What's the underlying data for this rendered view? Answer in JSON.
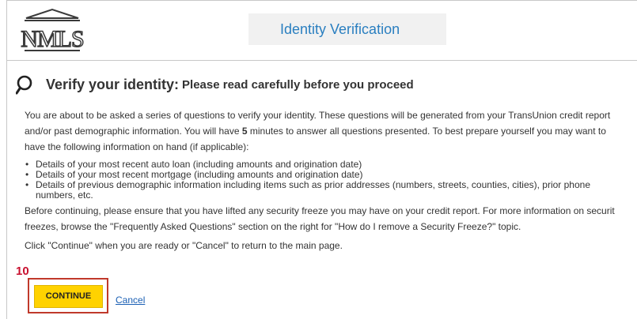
{
  "header": {
    "logo_text": "NMLS",
    "title": "Identity Verification"
  },
  "verify": {
    "title": "Verify your identity:",
    "subtitle": "Please read carefully before you proceed"
  },
  "intro": {
    "line1": "You are about to be asked a series of questions to verify your identity. These questions will be generated from your TransUnion credit report",
    "line2_a": "and/or past demographic information. You will have ",
    "line2_b": "5",
    "line2_c": " minutes to answer all questions presented. To best prepare yourself you may want to",
    "line3": "have the following information on hand (if applicable):"
  },
  "bullets": [
    "Details of your most recent auto loan (including amounts and origination date)",
    "Details of your most recent mortgage (including amounts and origination date)",
    "Details of previous demographic information including items such as prior addresses (numbers, streets, counties, cities), prior phone",
    "numbers, etc."
  ],
  "freeze": {
    "line1": "Before continuing, please ensure that you have lifted any security freeze you may have on your credit report. For more information on securit",
    "line2": "freezes, browse the \"Frequently Asked Questions\" section on the right for \"How do I remove a Security Freeze?\" topic."
  },
  "instruction": "Click \"Continue\" when you are ready or \"Cancel\" to return to the main page.",
  "step_number": "10",
  "buttons": {
    "continue_label": "CONTINUE",
    "cancel_label": "Cancel"
  },
  "colors": {
    "header_title": "#2a7fc0",
    "continue_bg": "#ffd200",
    "highlight": "#c0392b",
    "link": "#1a5fb4"
  }
}
